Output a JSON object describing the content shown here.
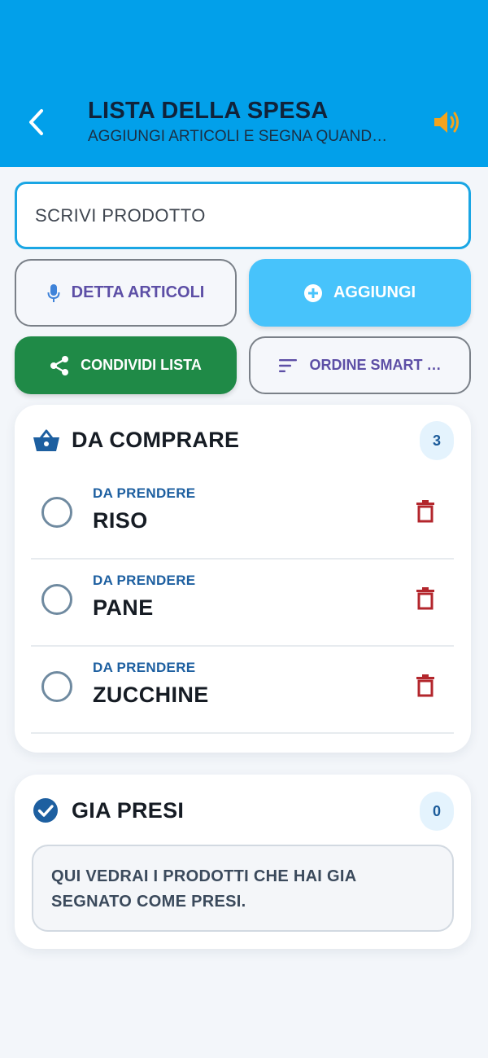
{
  "header": {
    "title": "LISTA DELLA SPESA",
    "subtitle": "AGGIUNGI ARTICOLI E SEGNA QUAND…"
  },
  "input": {
    "placeholder": "SCRIVI PRODOTTO",
    "value": ""
  },
  "actions": {
    "dictate_label": "DETTA ARTICOLI",
    "add_label": "AGGIUNGI",
    "share_label": "CONDIVIDI LISTA",
    "sort_label": "ORDINE SMART …"
  },
  "to_buy": {
    "title": "DA COMPRARE",
    "count": "3",
    "items": [
      {
        "status": "DA PRENDERE",
        "name": "RISO"
      },
      {
        "status": "DA PRENDERE",
        "name": "PANE"
      },
      {
        "status": "DA PRENDERE",
        "name": "ZUCCHINE"
      }
    ]
  },
  "taken": {
    "title": "GIA PRESI",
    "count": "0",
    "empty_message": "QUI VEDRAI I PRODOTTI CHE HAI GIA SEGNATO COME PRESI."
  },
  "colors": {
    "header_bg": "#02a0ea",
    "add_button": "#47c3fb",
    "share_button": "#1f8a47",
    "accent_text": "#5d4fa6",
    "delete_icon": "#b3262c",
    "sound_icon": "#f4a31c"
  },
  "icons": {
    "back": "chevron-left-icon",
    "sound": "speaker-icon",
    "dictate": "microphone-icon",
    "add": "plus-circle-icon",
    "share": "share-icon",
    "sort": "sort-lines-icon",
    "to_buy": "basket-icon",
    "taken": "check-circle-icon",
    "delete": "trash-icon"
  }
}
